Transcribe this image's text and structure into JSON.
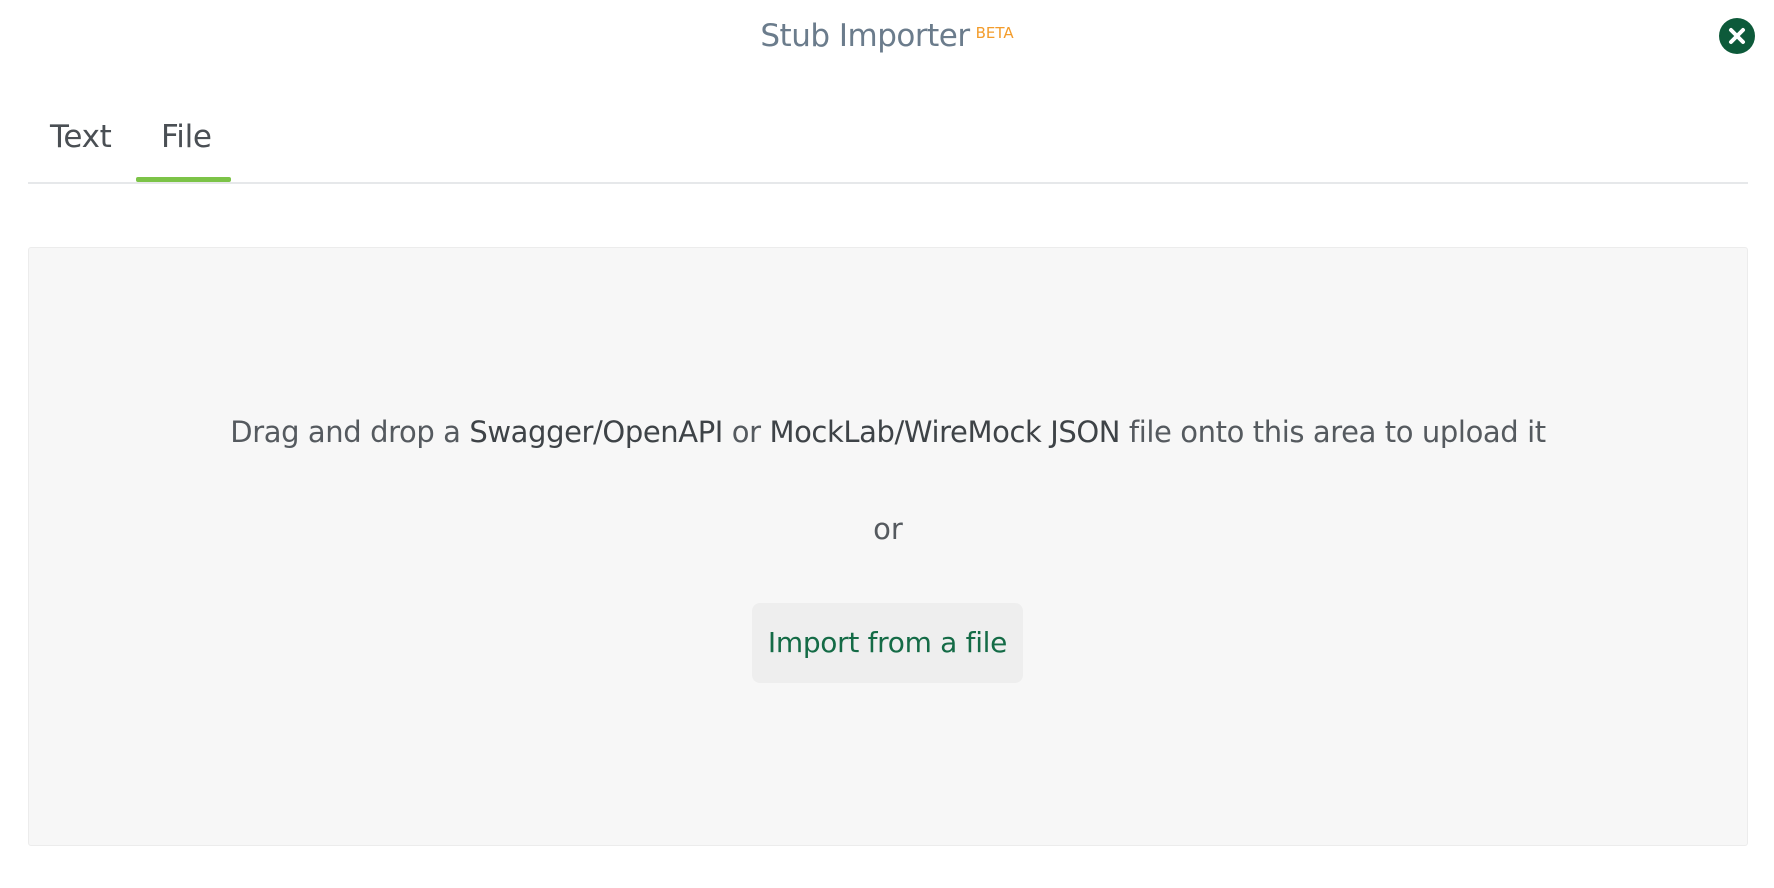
{
  "header": {
    "title": "Stub Importer",
    "badge": "BETA",
    "close_icon": "close-icon"
  },
  "tabs": [
    {
      "label": "Text",
      "active": false
    },
    {
      "label": "File",
      "active": true
    }
  ],
  "dropzone": {
    "text_prefix": "Drag and drop a ",
    "format_1": "Swagger/OpenAPI",
    "text_mid": " or ",
    "format_2": "MockLab/WireMock JSON",
    "text_suffix": " file onto this area to upload it",
    "or_label": "or",
    "import_button_label": "Import from a file"
  },
  "colors": {
    "accent_tab": "#7cc347",
    "close_button": "#0d5a3a",
    "badge": "#f39c2b",
    "button_text": "#146b46"
  }
}
